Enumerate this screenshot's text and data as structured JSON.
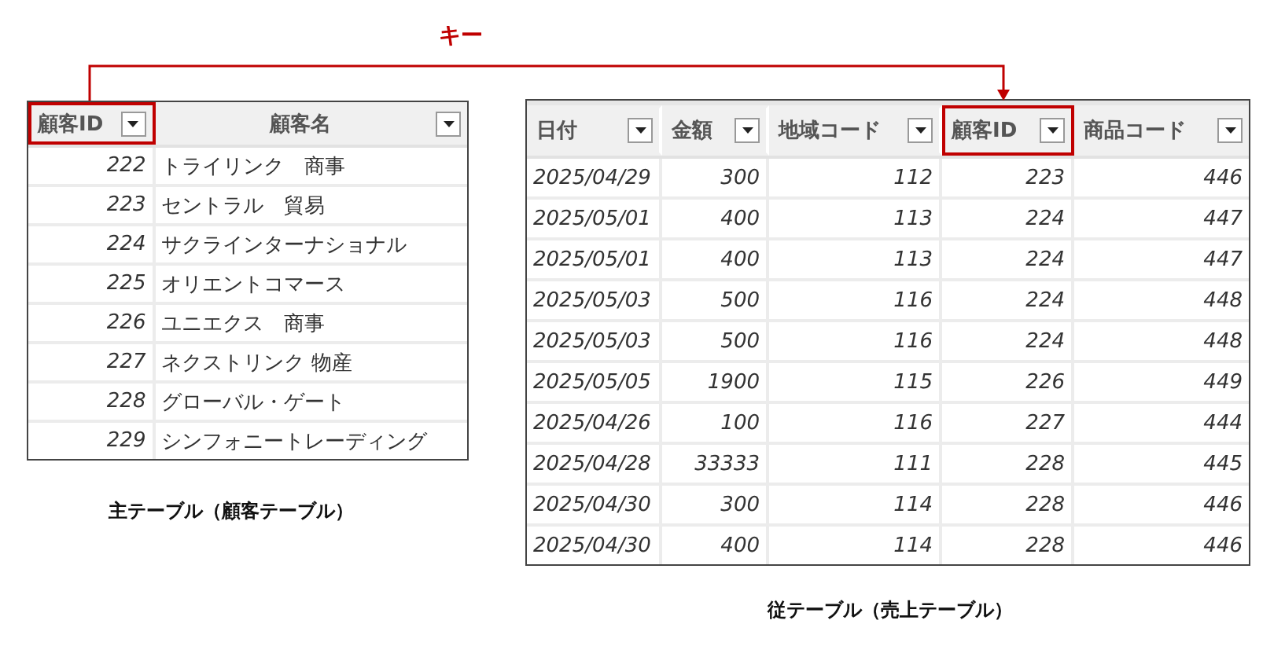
{
  "key_label": "キー",
  "left_table": {
    "columns": [
      {
        "label": "顧客ID",
        "highlighted": true,
        "kind": "number"
      },
      {
        "label": "顧客名",
        "highlighted": false,
        "kind": "text"
      }
    ],
    "rows": [
      [
        "222",
        "トライリンク　商事"
      ],
      [
        "223",
        "セントラル　貿易"
      ],
      [
        "224",
        "サクラインターナショナル"
      ],
      [
        "225",
        "オリエントコマース"
      ],
      [
        "226",
        "ユニエクス　商事"
      ],
      [
        "227",
        "ネクストリンク 物産"
      ],
      [
        "228",
        "グローバル・ゲート"
      ],
      [
        "229",
        "シンフォニートレーディング"
      ]
    ],
    "caption": "主テーブル（顧客テーブル）"
  },
  "right_table": {
    "columns": [
      {
        "label": "日付",
        "highlighted": false,
        "kind": "date"
      },
      {
        "label": "金額",
        "highlighted": false,
        "kind": "number"
      },
      {
        "label": "地域コード",
        "highlighted": false,
        "kind": "number"
      },
      {
        "label": "顧客ID",
        "highlighted": true,
        "kind": "number"
      },
      {
        "label": "商品コード",
        "highlighted": false,
        "kind": "number"
      }
    ],
    "rows": [
      [
        "2025/04/29",
        "300",
        "112",
        "223",
        "446"
      ],
      [
        "2025/05/01",
        "400",
        "113",
        "224",
        "447"
      ],
      [
        "2025/05/01",
        "400",
        "113",
        "224",
        "447"
      ],
      [
        "2025/05/03",
        "500",
        "116",
        "224",
        "448"
      ],
      [
        "2025/05/03",
        "500",
        "116",
        "224",
        "448"
      ],
      [
        "2025/05/05",
        "1900",
        "115",
        "226",
        "449"
      ],
      [
        "2025/04/26",
        "100",
        "116",
        "227",
        "444"
      ],
      [
        "2025/04/28",
        "33333",
        "111",
        "228",
        "445"
      ],
      [
        "2025/04/30",
        "300",
        "114",
        "228",
        "446"
      ],
      [
        "2025/04/30",
        "400",
        "114",
        "228",
        "446"
      ]
    ],
    "caption": "従テーブル（売上テーブル）"
  }
}
